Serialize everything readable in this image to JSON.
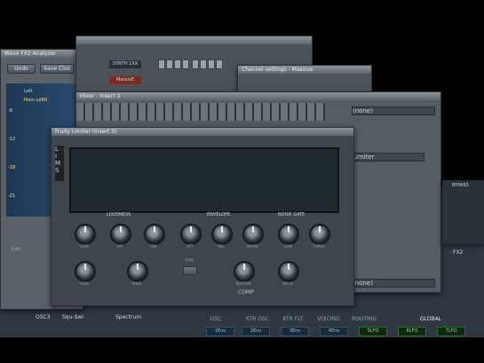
{
  "analyzer": {
    "title": "Wave FX2 Analyzer",
    "undo_label": "Undo",
    "save_label": "Save Clos",
    "legend_left": "Left",
    "legend_main": "Main LeftR",
    "scale_marks": [
      "-8",
      "-12",
      "-18",
      "-21"
    ],
    "side_label": "Cutf"
  },
  "step_seq": {
    "channel_1": "SYNTH 1XX",
    "channel_2": "MassivE"
  },
  "channel_settings": {
    "title": "Channel settings - Massive"
  },
  "mixer": {
    "title": "Mixer - Insert 3",
    "slot_label": "(none)",
    "slot_top": "(none)",
    "slot_bottom": "(none)",
    "limiter_label": "Limiter",
    "browse_label": "Browse",
    "bypass_label": "BYPASS",
    "fx_label": "FX2",
    "route_label": "Ro"
  },
  "limiter": {
    "title": "Fruity Limiter (Insert 3)",
    "side_tabs": [
      "L",
      "I",
      "M",
      "S"
    ],
    "mode_labels": [
      "LOUDNESS",
      "ENVELOPE",
      "NOISE GATE"
    ],
    "knobs": [
      "GAIN",
      "SAT",
      "CEIL",
      "ATT",
      "REL",
      "SHAPE",
      "GAIN",
      "THRES"
    ],
    "knobs_row2": [
      "GAIN",
      "KNEE",
      "SUSTAIN",
      "HOLD"
    ],
    "type_label": "TYPE",
    "comp_label": "COMP"
  },
  "massive": {
    "osc3_label": "OSC3",
    "osc3_mode": "Squ-Swl",
    "osc3_view": "Spectrum",
    "osc3_params": [
      "Pitch",
      "Wt-position",
      "Intensity",
      "Amp"
    ],
    "tabs": [
      "OSC",
      "KTR OSC",
      "KTR FLT",
      "VOICING",
      "ROUTING",
      "GLOBAL"
    ],
    "env_buttons": [
      "1Env",
      "2Env",
      "3Env",
      "4Env",
      "5LFO",
      "6LFO",
      "7LFO"
    ]
  },
  "colors": {
    "accent_green": "#7ef07e",
    "accent_blue": "#9bc6e8"
  }
}
